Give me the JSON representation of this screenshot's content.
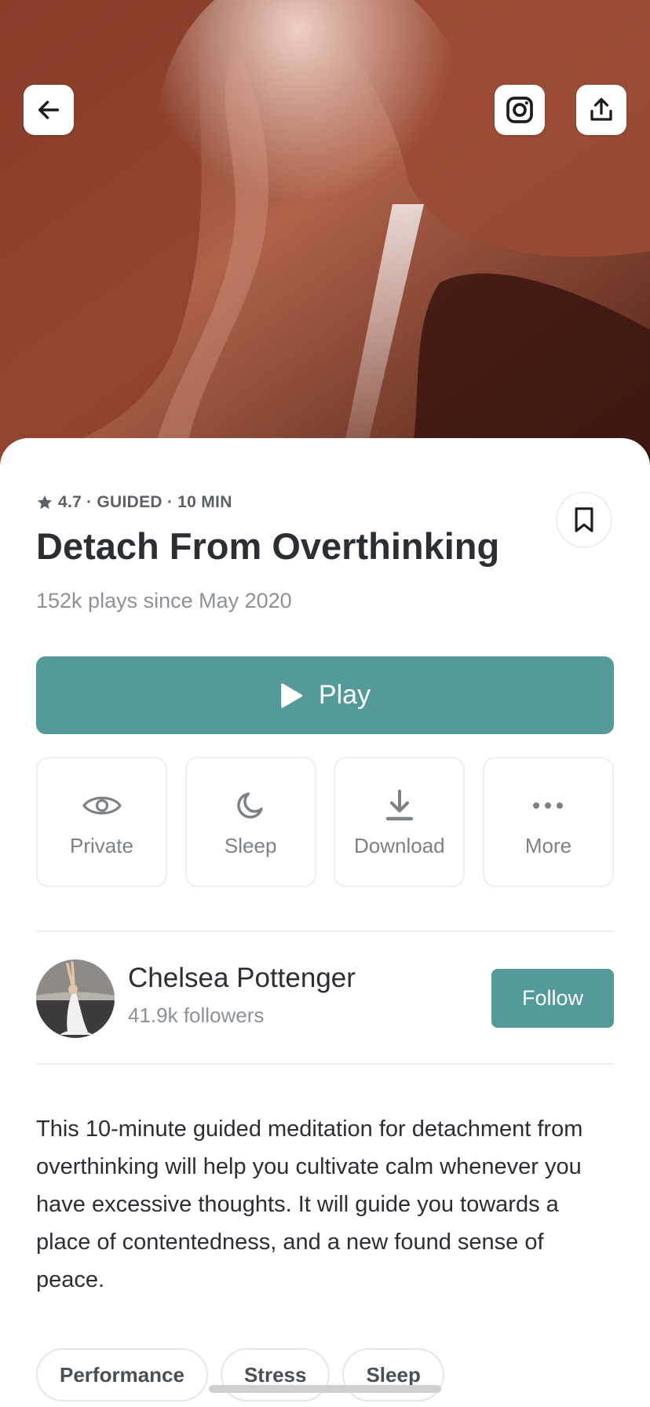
{
  "header": {
    "back_icon": "arrow-left-icon",
    "instagram_icon": "instagram-icon",
    "share_icon": "share-icon",
    "hero_image": "slot-canyon-photo"
  },
  "meta": {
    "rating": "4.7",
    "type": "GUIDED",
    "duration": "10 MIN",
    "separator": "·"
  },
  "title": "Detach From Overthinking",
  "plays": "152k plays since May 2020",
  "bookmark_icon": "bookmark-icon",
  "play_button": {
    "label": "Play",
    "color": "#559a9a"
  },
  "actions": [
    {
      "label": "Private",
      "icon": "eye-icon"
    },
    {
      "label": "Sleep",
      "icon": "moon-icon"
    },
    {
      "label": "Download",
      "icon": "download-icon"
    },
    {
      "label": "More",
      "icon": "more-dots-icon"
    }
  ],
  "author": {
    "name": "Chelsea Pottenger",
    "followers": "41.9k followers",
    "follow_label": "Follow"
  },
  "description": "This 10-minute guided meditation for detachment from overthinking will help you cultivate calm whenever you have excessive thoughts. It will guide you towards a place of contentedness, and a new found sense of peace.",
  "tags": [
    "Performance",
    "Stress",
    "Sleep"
  ]
}
